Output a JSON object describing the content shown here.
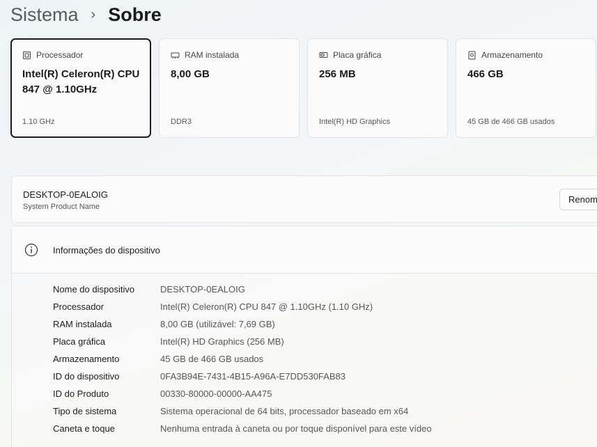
{
  "breadcrumb": {
    "parent": "Sistema",
    "separator": "›",
    "current": "Sobre"
  },
  "cards": [
    {
      "label": "Processador",
      "value": "Intel(R) Celeron(R) CPU 847 @ 1.10GHz",
      "sub": "1.10 GHz",
      "icon": "processor-icon"
    },
    {
      "label": "RAM instalada",
      "value": "8,00 GB",
      "sub": "DDR3",
      "icon": "ram-icon"
    },
    {
      "label": "Placa gráfica",
      "value": "256 MB",
      "sub": "Intel(R) HD Graphics",
      "icon": "gpu-icon"
    },
    {
      "label": "Armazenamento",
      "value": "466 GB",
      "sub": "45 GB de 466 GB usados",
      "icon": "storage-icon"
    }
  ],
  "device": {
    "name": "DESKTOP-0EALOIG",
    "subtitle": "System Product Name",
    "rename_label": "Renomear"
  },
  "info": {
    "title": "Informações do dispositivo",
    "rows": [
      {
        "key": "Nome do dispositivo",
        "value": "DESKTOP-0EALOIG"
      },
      {
        "key": "Processador",
        "value": "Intel(R) Celeron(R) CPU 847 @ 1.10GHz (1.10 GHz)"
      },
      {
        "key": "RAM instalada",
        "value": "8,00 GB (utilizável: 7,69 GB)"
      },
      {
        "key": "Placa gráfica",
        "value": "Intel(R) HD Graphics (256 MB)"
      },
      {
        "key": "Armazenamento",
        "value": "45 GB de 466 GB usados"
      },
      {
        "key": "ID do dispositivo",
        "value": "0FA3B94E-7431-4B15-A96A-E7DD530FAB83"
      },
      {
        "key": "ID do Produto",
        "value": "00330-80000-00000-AA475"
      },
      {
        "key": "Tipo de sistema",
        "value": "Sistema operacional de 64 bits, processador baseado em x64"
      },
      {
        "key": "Caneta e toque",
        "value": "Nenhuma entrada à caneta ou por toque disponível para este vídeo"
      }
    ]
  }
}
